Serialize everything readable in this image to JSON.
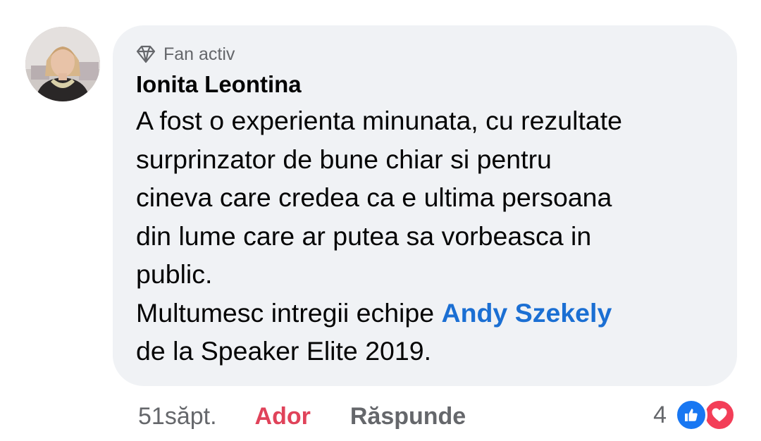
{
  "comment": {
    "badge_label": "Fan activ",
    "badge_icon": "diamond-icon",
    "author": "Ionita Leontina",
    "body_lines": [
      "A fost o experienta minunata, cu rezultate",
      "surprinzator de bune chiar si pentru",
      "cineva care credea ca e ultima persoana",
      "din lume care ar putea sa vorbeasca in",
      "public."
    ],
    "thanks_prefix": "Multumesc intregii echipe ",
    "mention": "Andy Szekely",
    "last_line": "de la Speaker Elite 2019."
  },
  "actions": {
    "time": "51săpt.",
    "love_label": "Ador",
    "reply_label": "Răspunde"
  },
  "reactions": {
    "count": "4",
    "types": [
      "like-icon",
      "love-icon"
    ],
    "like_color": "#1877f2",
    "love_color": "#f33e58"
  },
  "colors": {
    "bubble": "#f0f2f5",
    "mention": "#1b6fd3",
    "love_action": "#e0435a",
    "secondary_text": "#65676b"
  }
}
